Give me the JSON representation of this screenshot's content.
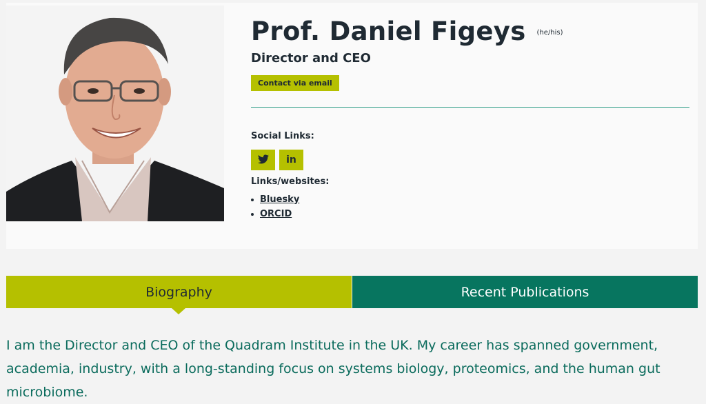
{
  "profile": {
    "name": "Prof. Daniel Figeys",
    "pronouns": "(he/his)",
    "role": "Director and CEO",
    "contact_label": "Contact via email"
  },
  "social": {
    "label": "Social Links:",
    "items": [
      {
        "icon": "twitter-icon"
      },
      {
        "icon": "linkedin-icon",
        "glyph": "in"
      }
    ]
  },
  "links": {
    "label": "Links/websites:",
    "items": [
      "Bluesky",
      "ORCID"
    ]
  },
  "tabs": {
    "biography": "Biography",
    "publications": "Recent Publications"
  },
  "biography_text": "I am the Director and CEO of the Quadram Institute in the UK. My career has spanned government, academia, industry, with a long-standing focus on systems biology, proteomics, and the human gut microbiome.",
  "colors": {
    "accent_lime": "#b5c000",
    "accent_teal": "#07755f",
    "text_dark": "#1f2a33",
    "bio_text": "#0a6b5c"
  }
}
